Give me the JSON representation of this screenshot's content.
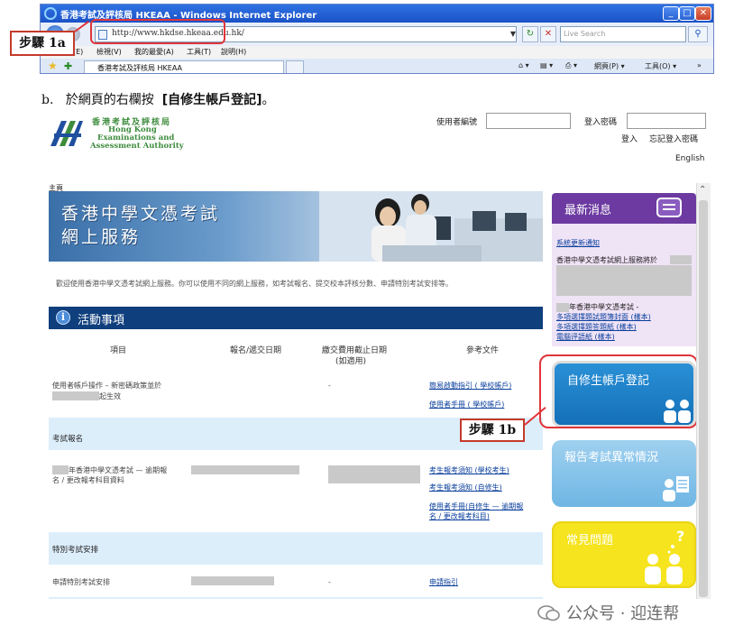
{
  "browser": {
    "title": "香港考試及評核局 HKEAA - Windows Internet Explorer",
    "url": "http://www.hkdse.hkeaa.edu.hk/",
    "search_placeholder": "Live Search",
    "menu": [
      "編輯(E)",
      "檢視(V)",
      "我的最愛(A)",
      "工具(T)",
      "說明(H)"
    ],
    "tab_title": "香港考試及評核局 HKEAA",
    "tools": [
      "網頁(P) ▾",
      "工具(O) ▾"
    ]
  },
  "steps": {
    "step_1a": "步驟  1a",
    "step_1b": "步驟  1b"
  },
  "instruction": {
    "marker": "b.",
    "text": "於網頁的右欄按",
    "emphasis": "[自修生帳戶登記]",
    "end": "。"
  },
  "header": {
    "logo_zh": "香港考試及評核局",
    "logo_en": [
      "Hong Kong",
      "Examinations and",
      "Assessment Authority"
    ],
    "user_label": "使用者編號",
    "pass_label": "登入密碼",
    "login": "登入",
    "forgot": "忘記登入密碼",
    "language": "English",
    "home": "主頁"
  },
  "banner": {
    "line1": "香港中學文憑考試",
    "line2": "網上服務",
    "welcome": "歡迎使用香港中學文憑考試網上服務。你可以使用不同的網上服務，如考試報名、提交校本評核分數、申請特別考試安排等。"
  },
  "activities": {
    "title": "活動事項",
    "headers": [
      "項目",
      "報名/遞交日期",
      "繳交費用截止日期",
      "(如適用)",
      "參考文件"
    ],
    "row1": {
      "item_a": "使用者帳戶操作 – 新密碼政策並於",
      "item_b": "起生效",
      "fee": "-",
      "docs": [
        "簡易啟動指引 ( 學校帳戶)",
        "使用者手冊 ( 學校帳戶)"
      ]
    },
    "section_exam": "考試報名",
    "row2": {
      "item_a": "年香港中學文憑考試 — 逾期報",
      "item_b": "名 / 更改報考科目資料",
      "docs": [
        "考生報考須知 (學校考生)",
        "考生報考須知 (自修生)",
        "使用者手冊(自修生 — 逾期報",
        "名 / 更改報考科目)"
      ]
    },
    "section_special": "特別考試安排",
    "row3": {
      "item": "申請特別考試安排",
      "fee": "-",
      "docs": [
        "申請指引"
      ]
    }
  },
  "news": {
    "title": "最新消息",
    "link1": "系統更新通知",
    "text1": "香港中學文憑考試網上服務將於",
    "text2": "年香港中學文憑考試 -",
    "link2": "多項選擇題試題簿封面 (樣本)",
    "link3": "多項選擇題答題紙 (樣本)",
    "link4": "電腦评語紙 (樣本)"
  },
  "tiles": {
    "register": "自修生帳戶登記",
    "report": "報告考試異常情況",
    "faq": "常見問題"
  },
  "watermark": "公众号 · 迎连帮",
  "colors": {
    "activity_bar": "#0f3f7d",
    "news_header": "#6c3aa0",
    "register_tile": "#1a7fc7",
    "report_tile": "#86c3ea",
    "faq_tile": "#f5e41e",
    "highlight": "#e0353a"
  }
}
